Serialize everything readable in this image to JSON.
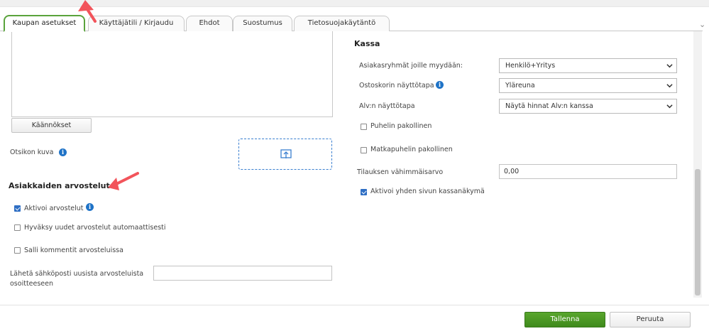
{
  "tabs": [
    {
      "label": "Kaupan asetukset",
      "active": true
    },
    {
      "label": "Käyttäjätili / Kirjaudu",
      "active": false
    },
    {
      "label": "Ehdot",
      "active": false
    },
    {
      "label": "Suostumus",
      "active": false
    },
    {
      "label": "Tietosuojakäytäntö",
      "active": false
    }
  ],
  "left": {
    "translations_button": "Käännökset",
    "title_image_label": "Otsikon kuva",
    "reviews_heading": "Asiakkaiden arvostelut",
    "enable_reviews": {
      "label": "Aktivoi arvostelut",
      "checked": true
    },
    "auto_approve": {
      "label": "Hyväksy uudet arvostelut automaattisesti",
      "checked": false
    },
    "allow_comments": {
      "label": "Salli kommentit arvosteluissa",
      "checked": false
    },
    "email_label_line1": "Lähetä sähköposti uusista arvosteluista",
    "email_label_line2": "osoitteeseen",
    "email_value": ""
  },
  "right": {
    "heading": "Kassa",
    "customer_groups": {
      "label": "Asiakasryhmät joille myydään:",
      "value": "Henkilö+Yritys"
    },
    "cart_display": {
      "label": "Ostoskorin näyttötapa",
      "value": "Yläreuna"
    },
    "vat_display": {
      "label": "Alv:n näyttötapa",
      "value": "Näytä hinnat Alv:n kanssa"
    },
    "phone_required": {
      "label": "Puhelin pakollinen",
      "checked": false
    },
    "mobile_required": {
      "label": "Matkapuhelin pakollinen",
      "checked": false
    },
    "min_order": {
      "label": "Tilauksen vähimmäisarvo",
      "value": "0,00"
    },
    "one_page_checkout": {
      "label": "Aktivoi yhden sivun kassanäkymä",
      "checked": true
    }
  },
  "footer": {
    "save_label": "Tallenna",
    "cancel_label": "Peruuta"
  },
  "colors": {
    "accent_green": "#4c9a25",
    "info_blue": "#1f73c7",
    "arrow_red": "#f2545b"
  }
}
